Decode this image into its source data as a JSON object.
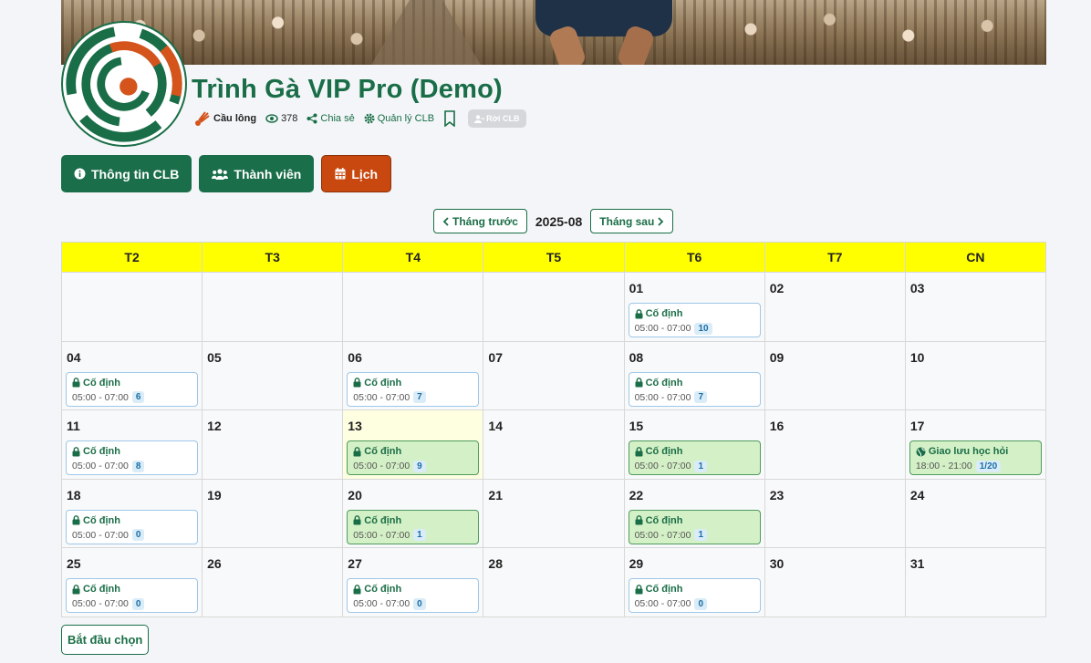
{
  "club": {
    "title": "Trình Gà VIP Pro (Demo)",
    "sport": "Cầu lông",
    "views": "378",
    "share_label": "Chia sẻ",
    "manage_label": "Quản lý CLB",
    "leave_label": "Rời CLB",
    "brand_green": "#1a6e47",
    "brand_orange": "#d4541c"
  },
  "tabs": [
    {
      "label": "Thông tin CLB",
      "icon": "info-circle-icon"
    },
    {
      "label": "Thành viên",
      "icon": "users-icon"
    },
    {
      "label": "Lịch",
      "icon": "calendar-icon",
      "active": true
    }
  ],
  "month_nav": {
    "prev_label": "Tháng trước",
    "current": "2025-08",
    "next_label": "Tháng sau"
  },
  "calendar": {
    "weekdays": [
      "T2",
      "T3",
      "T4",
      "T5",
      "T6",
      "T7",
      "CN"
    ],
    "weeks": [
      [
        {
          "day": ""
        },
        {
          "day": ""
        },
        {
          "day": ""
        },
        {
          "day": ""
        },
        {
          "day": "01",
          "event": {
            "title": "Cố định",
            "time": "05:00 - 07:00",
            "count": "10",
            "style": "blue",
            "icon": "lock-icon"
          }
        },
        {
          "day": "02"
        },
        {
          "day": "03"
        }
      ],
      [
        {
          "day": "04",
          "event": {
            "title": "Cố định",
            "time": "05:00 - 07:00",
            "count": "6",
            "style": "blue",
            "icon": "lock-icon"
          }
        },
        {
          "day": "05"
        },
        {
          "day": "06",
          "event": {
            "title": "Cố định",
            "time": "05:00 - 07:00",
            "count": "7",
            "style": "blue",
            "icon": "lock-icon"
          }
        },
        {
          "day": "07"
        },
        {
          "day": "08",
          "event": {
            "title": "Cố định",
            "time": "05:00 - 07:00",
            "count": "7",
            "style": "blue",
            "icon": "lock-icon"
          }
        },
        {
          "day": "09"
        },
        {
          "day": "10"
        }
      ],
      [
        {
          "day": "11",
          "event": {
            "title": "Cố định",
            "time": "05:00 - 07:00",
            "count": "8",
            "style": "blue",
            "icon": "lock-icon"
          }
        },
        {
          "day": "12"
        },
        {
          "day": "13",
          "today": true,
          "event": {
            "title": "Cố định",
            "time": "05:00 - 07:00",
            "count": "9",
            "style": "green",
            "icon": "lock-icon"
          }
        },
        {
          "day": "14"
        },
        {
          "day": "15",
          "event": {
            "title": "Cố định",
            "time": "05:00 - 07:00",
            "count": "1",
            "style": "green",
            "icon": "lock-icon"
          }
        },
        {
          "day": "16"
        },
        {
          "day": "17",
          "event": {
            "title": "Giao lưu học hỏi",
            "time": "18:00 - 21:00",
            "count": "1/20",
            "style": "green",
            "icon": "globe-icon"
          }
        }
      ],
      [
        {
          "day": "18",
          "event": {
            "title": "Cố định",
            "time": "05:00 - 07:00",
            "count": "0",
            "style": "blue",
            "icon": "lock-icon"
          }
        },
        {
          "day": "19"
        },
        {
          "day": "20",
          "event": {
            "title": "Cố định",
            "time": "05:00 - 07:00",
            "count": "1",
            "style": "green",
            "icon": "lock-icon"
          }
        },
        {
          "day": "21"
        },
        {
          "day": "22",
          "event": {
            "title": "Cố định",
            "time": "05:00 - 07:00",
            "count": "1",
            "style": "green",
            "icon": "lock-icon"
          }
        },
        {
          "day": "23"
        },
        {
          "day": "24"
        }
      ],
      [
        {
          "day": "25",
          "event": {
            "title": "Cố định",
            "time": "05:00 - 07:00",
            "count": "0",
            "style": "blue",
            "icon": "lock-icon"
          }
        },
        {
          "day": "26"
        },
        {
          "day": "27",
          "event": {
            "title": "Cố định",
            "time": "05:00 - 07:00",
            "count": "0",
            "style": "blue",
            "icon": "lock-icon"
          }
        },
        {
          "day": "28"
        },
        {
          "day": "29",
          "event": {
            "title": "Cố định",
            "time": "05:00 - 07:00",
            "count": "0",
            "style": "blue",
            "icon": "lock-icon"
          }
        },
        {
          "day": "30"
        },
        {
          "day": "31"
        }
      ]
    ]
  },
  "start_button_label": "Bắt đầu chọn"
}
